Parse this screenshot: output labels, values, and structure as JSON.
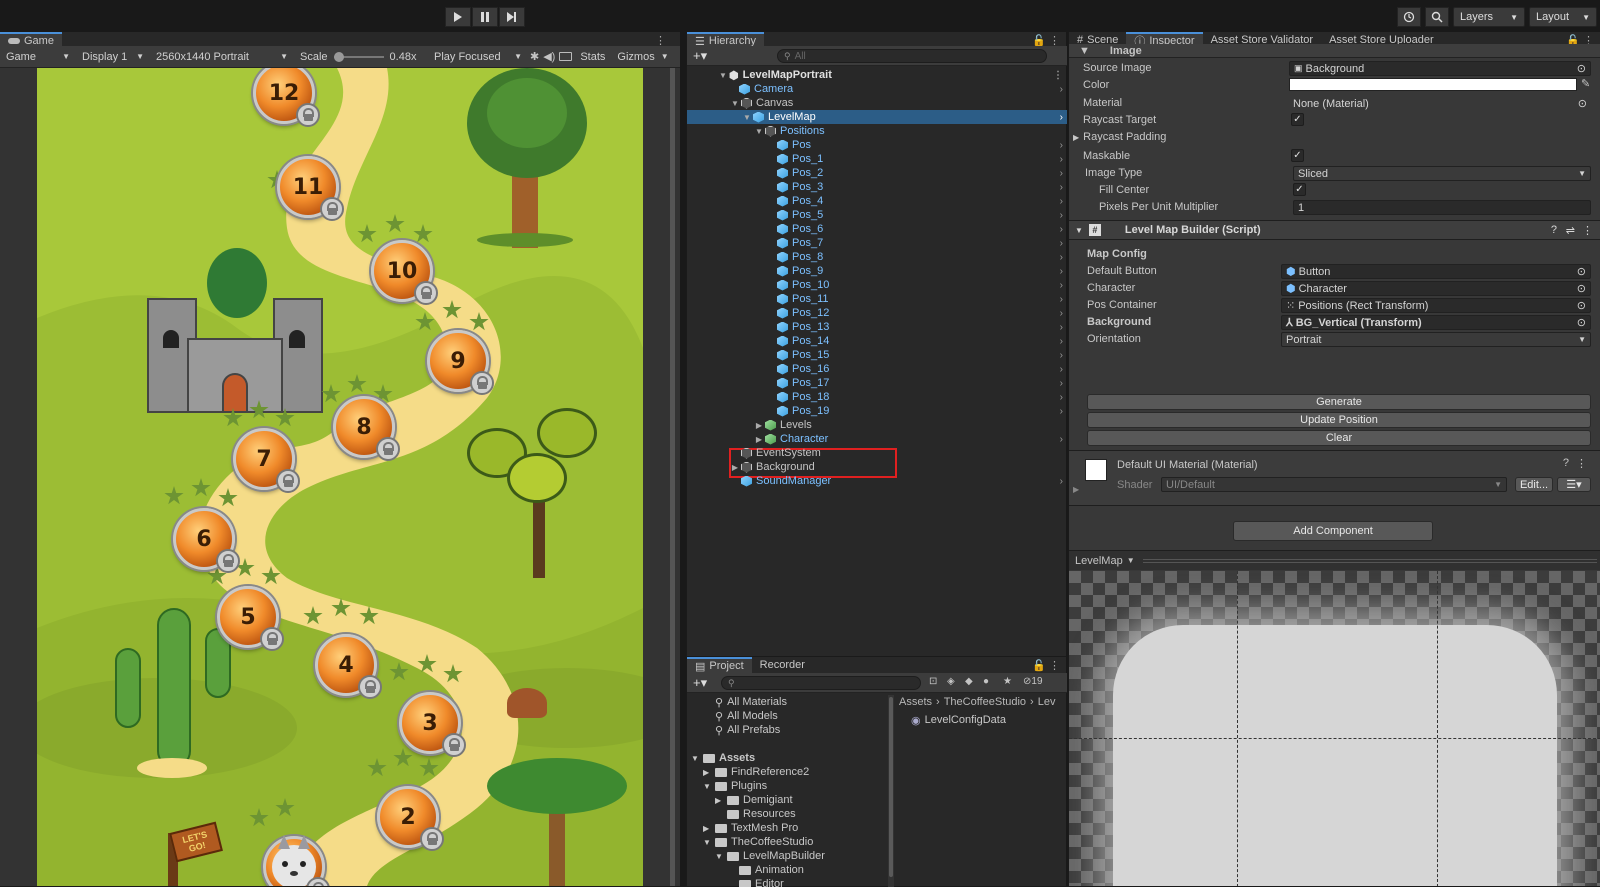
{
  "toolbar": {
    "layers": "Layers",
    "layout": "Layout"
  },
  "game": {
    "tab": "Game",
    "mode": "Game",
    "display": "Display 1",
    "resolution": "2560x1440 Portrait",
    "scale_label": "Scale",
    "scale_value": "0.48x",
    "play_mode": "Play Focused",
    "stats": "Stats",
    "gizmos": "Gizmos",
    "levels": [
      "12",
      "11",
      "10",
      "9",
      "8",
      "7",
      "6",
      "5",
      "4",
      "3",
      "2"
    ],
    "sign_text": "LET'S GO!"
  },
  "hierarchy": {
    "tab": "Hierarchy",
    "search_placeholder": "All",
    "root": "LevelMapPortrait",
    "items": [
      {
        "label": "Camera"
      },
      {
        "label": "Canvas"
      },
      {
        "label": "LevelMap"
      },
      {
        "label": "Positions"
      },
      {
        "label": "Pos"
      },
      {
        "label": "Pos_1"
      },
      {
        "label": "Pos_2"
      },
      {
        "label": "Pos_3"
      },
      {
        "label": "Pos_4"
      },
      {
        "label": "Pos_5"
      },
      {
        "label": "Pos_6"
      },
      {
        "label": "Pos_7"
      },
      {
        "label": "Pos_8"
      },
      {
        "label": "Pos_9"
      },
      {
        "label": "Pos_10"
      },
      {
        "label": "Pos_11"
      },
      {
        "label": "Pos_12"
      },
      {
        "label": "Pos_13"
      },
      {
        "label": "Pos_14"
      },
      {
        "label": "Pos_15"
      },
      {
        "label": "Pos_16"
      },
      {
        "label": "Pos_17"
      },
      {
        "label": "Pos_18"
      },
      {
        "label": "Pos_19"
      },
      {
        "label": "Levels"
      },
      {
        "label": "Character"
      },
      {
        "label": "EventSystem"
      },
      {
        "label": "Background"
      },
      {
        "label": "SoundManager"
      }
    ]
  },
  "project": {
    "tab": "Project",
    "tab2": "Recorder",
    "count": "19",
    "favorites": [
      "All Materials",
      "All Models",
      "All Prefabs"
    ],
    "tree": [
      {
        "label": "Assets"
      },
      {
        "label": "FindReference2"
      },
      {
        "label": "Plugins"
      },
      {
        "label": "Demigiant"
      },
      {
        "label": "Resources"
      },
      {
        "label": "TextMesh Pro"
      },
      {
        "label": "TheCoffeeStudio"
      },
      {
        "label": "LevelMapBuilder"
      },
      {
        "label": "Animation"
      },
      {
        "label": "Editor"
      }
    ],
    "breadcrumb": [
      "Assets",
      "TheCoffeeStudio",
      "Lev"
    ],
    "files": [
      "LevelConfigData"
    ]
  },
  "inspector": {
    "tabs": [
      "Scene",
      "Inspector",
      "Asset Store Validator",
      "Asset Store Uploader"
    ],
    "image_header": "Image",
    "source_image_label": "Source Image",
    "source_image_value": "Background",
    "color_label": "Color",
    "material_label": "Material",
    "material_value": "None (Material)",
    "raycast_target_label": "Raycast Target",
    "raycast_padding_label": "Raycast Padding",
    "maskable_label": "Maskable",
    "image_type_label": "Image Type",
    "image_type_value": "Sliced",
    "fill_center_label": "Fill Center",
    "ppu_label": "Pixels Per Unit Multiplier",
    "ppu_value": "1",
    "script_header": "Level Map Builder (Script)",
    "map_config": "Map Config",
    "default_button_label": "Default Button",
    "default_button_value": "Button",
    "character_label": "Character",
    "character_value": "Character",
    "pos_container_label": "Pos Container",
    "pos_container_value": "Positions (Rect Transform)",
    "background_label": "Background",
    "background_value": "BG_Vertical (Transform)",
    "orientation_label": "Orientation",
    "orientation_value": "Portrait",
    "generate": "Generate",
    "update_position": "Update Position",
    "clear": "Clear",
    "material_header": "Default UI Material (Material)",
    "shader_label": "Shader",
    "shader_value": "UI/Default",
    "edit": "Edit...",
    "add_component": "Add Component",
    "preview_title": "LevelMap"
  }
}
